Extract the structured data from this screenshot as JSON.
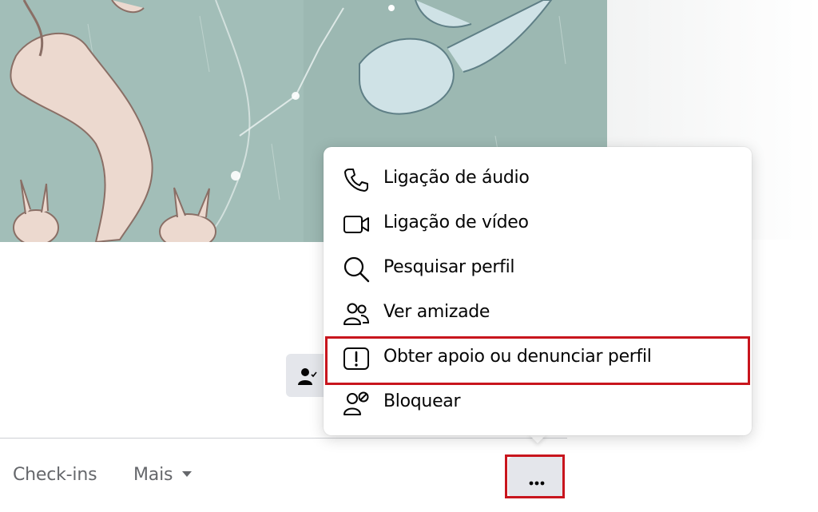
{
  "cover": {
    "alt_icon": "illustration-cover-photo"
  },
  "tabs": [
    {
      "label": "Check-ins"
    },
    {
      "label": "Mais",
      "icon": "caret-down-icon"
    }
  ],
  "more_button": {
    "icon": "ellipsis-icon"
  },
  "friend_button": {
    "icon": "person-check-icon"
  },
  "menu": {
    "items": [
      {
        "label": "Ligação de áudio",
        "icon": "phone-icon"
      },
      {
        "label": "Ligação de vídeo",
        "icon": "video-camera-icon"
      },
      {
        "label": "Pesquisar perfil",
        "icon": "search-icon"
      },
      {
        "label": "Ver amizade",
        "icon": "friends-icon"
      },
      {
        "label": "Obter apoio ou denunciar perfil",
        "icon": "report-icon",
        "highlighted": true
      },
      {
        "label": "Bloquear",
        "icon": "block-user-icon"
      }
    ]
  },
  "colors": {
    "highlight": "#c8151d",
    "muted_text": "#65676b",
    "button_bg": "#e4e6eb"
  }
}
